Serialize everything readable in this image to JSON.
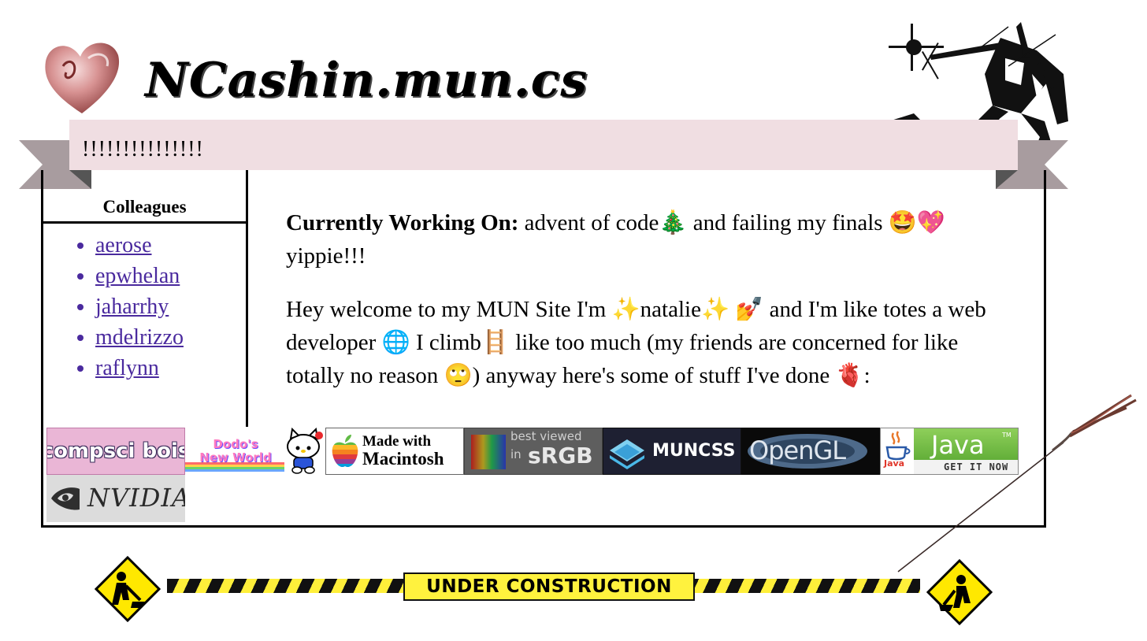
{
  "site": {
    "title": "NCashin.mun.cs",
    "banner": "!!!!!!!!!!!!!!!"
  },
  "sidebar": {
    "heading": "Colleagues",
    "colleagues": [
      "aerose",
      "epwhelan",
      "jaharrhy",
      "mdelrizzo",
      "raflynn"
    ]
  },
  "content": {
    "working_label": "Currently Working On:",
    "working_text": " advent of code🎄 and failing my finals 🤩💖 yippie!!!",
    "intro": "Hey welcome to my MUN Site I'm ✨natalie✨ 💅 and I'm like totes a web developer 🌐 I climb🪜 like too much (my friends are concerned for like totally no reason 🙄) anyway here's some of stuff I've done 🫀:"
  },
  "badges": {
    "compsci": "compsci bois",
    "dodo_line1": "Dodo's",
    "dodo_line2": "New World",
    "mac_line1": "Made with",
    "mac_line2": "Macintosh",
    "srgb_line1": "best viewed",
    "srgb_line2": "in",
    "srgb_line3": "sRGB",
    "muncss": "MUNCSS",
    "opengl": "OpenGL",
    "java_small": "Java",
    "java": "Java",
    "java_tm": "TM",
    "java_cta": "GET IT NOW",
    "nvidia": "NVIDIA."
  },
  "construction": {
    "label": "UNDER CONSTRUCTION"
  },
  "colors": {
    "banner_bg": "#f0dee2",
    "ribbon_tail": "#a89c9f",
    "link": "#4a2a9e",
    "caution_yellow": "#fff23e"
  }
}
